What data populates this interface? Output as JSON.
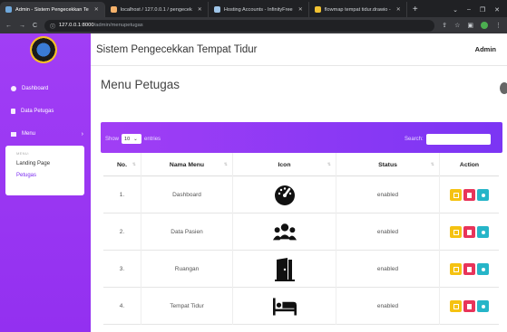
{
  "browser": {
    "tabs": [
      {
        "label": "Admin - Sistem Pengecekkan Te",
        "active": true,
        "color": "#6fa8dc"
      },
      {
        "label": "localhost / 127.0.0.1 / pengecek",
        "active": false,
        "color": "#f6b26b"
      },
      {
        "label": "Hosting Accounts - InfinityFree",
        "active": false,
        "color": "#9fc5e8"
      },
      {
        "label": "flowmap tempat tidur.drawio - ",
        "active": false,
        "color": "#f1c232"
      }
    ],
    "new_tab": "+",
    "url_host": "127.0.0.1:8000",
    "url_path": "/admin/menupetugas"
  },
  "app": {
    "title": "Sistem Pengecekkan Tempat Tidur",
    "user": "Admin",
    "page_title": "Menu Petugas"
  },
  "sidebar": {
    "items": [
      {
        "label": "Dashboard"
      },
      {
        "label": "Data Petugas"
      },
      {
        "label": "Menu",
        "chevron": "›"
      }
    ],
    "submenu": {
      "header": "MENU:",
      "items": [
        {
          "label": "Landing Page",
          "active": false
        },
        {
          "label": "Petugas",
          "active": true
        }
      ]
    }
  },
  "table_controls": {
    "show_label": "Show",
    "length_value": "10",
    "entries_label": "entries",
    "search_label": "Search:"
  },
  "table": {
    "headers": [
      "No.",
      "Nama Menu",
      "Icon",
      "Status",
      "Action"
    ],
    "rows": [
      {
        "no": "1.",
        "name": "Dashboard",
        "icon": "gauge-icon",
        "status": "enabled"
      },
      {
        "no": "2.",
        "name": "Data Pasien",
        "icon": "users-icon",
        "status": "enabled"
      },
      {
        "no": "3.",
        "name": "Ruangan",
        "icon": "door-icon",
        "status": "enabled"
      },
      {
        "no": "4.",
        "name": "Tempat Tidur",
        "icon": "bed-icon",
        "status": "enabled"
      }
    ]
  },
  "colors": {
    "sidebar": "#9b38f3",
    "edit_button": "#f5c211",
    "delete_button": "#e8345a",
    "detail_button": "#26b5c8"
  }
}
